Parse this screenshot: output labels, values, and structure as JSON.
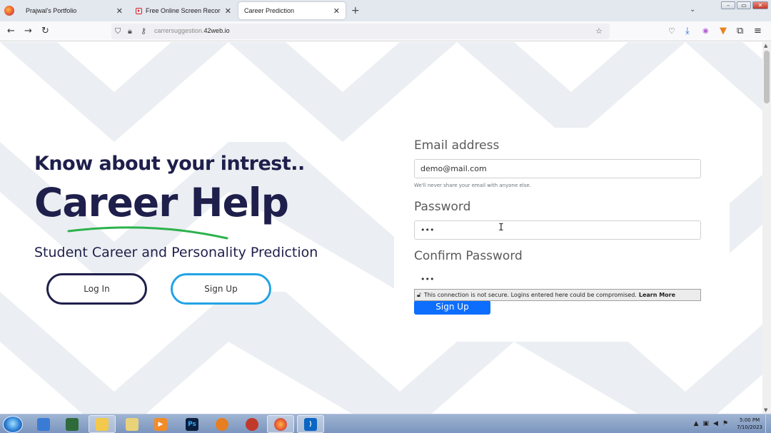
{
  "browser": {
    "tabs": [
      {
        "label": "Prajwal's Portfolio",
        "active": false
      },
      {
        "label": "Free Online Screen Recorder &",
        "active": false
      },
      {
        "label": "Career Prediction",
        "active": true
      }
    ],
    "url_domain": "carrersuggestion.",
    "url_host": "42web.io"
  },
  "hero": {
    "tagline": "Know about your intrest..",
    "title": "Career Help",
    "subtitle": "Student Career and Personality Prediction",
    "login_label": "Log In",
    "signup_label": "Sign Up",
    "underline_color": "#2bb24c"
  },
  "form": {
    "email_label": "Email address",
    "email_value": "demo@mail.com",
    "email_help": "We'll never share your email with anyone else.",
    "password_label": "Password",
    "password_value": "•••",
    "confirm_label": "Confirm Password",
    "confirm_value": "•••",
    "insecure_text": "This connection is not secure. Logins entered here could be compromised.",
    "learn_more": "Learn More",
    "submit_label": "Sign Up"
  },
  "colors": {
    "navy": "#1e1f4b",
    "accent_blue": "#22a3e6",
    "primary": "#0d6efd"
  },
  "taskbar": {
    "apps": [
      {
        "icon": "remote-desktop-icon",
        "open": false
      },
      {
        "icon": "task-manager-icon",
        "open": false
      },
      {
        "icon": "file-explorer-icon",
        "open": true
      },
      {
        "icon": "libraries-icon",
        "open": false
      },
      {
        "icon": "media-player-icon",
        "open": false
      },
      {
        "icon": "photoshop-icon",
        "open": false,
        "text": "Ps"
      },
      {
        "icon": "fl-studio-icon",
        "open": false
      },
      {
        "icon": "snipping-tool-icon",
        "open": false
      },
      {
        "icon": "firefox-icon",
        "open": true
      },
      {
        "icon": "vscode-icon",
        "open": true
      }
    ],
    "time": "5:00 PM",
    "date": "7/10/2023"
  }
}
